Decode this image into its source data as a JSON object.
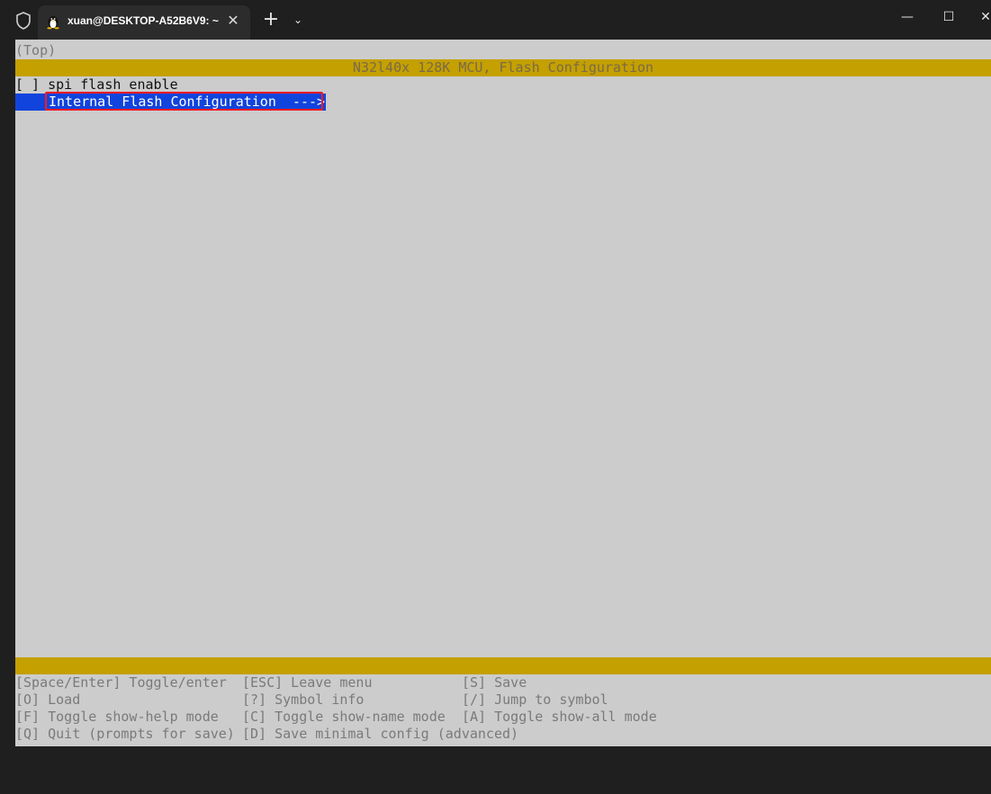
{
  "window": {
    "tab_title": "xuan@DESKTOP-A52B6V9: ~/",
    "tab_close": "✕",
    "new_tab": "+",
    "tab_dropdown": "⌄",
    "minimize": "—",
    "maximize": "☐",
    "close": "✕",
    "icons": [
      "shield-icon",
      "linux-penguin-icon"
    ]
  },
  "terminal": {
    "breadcrumb": "(Top)",
    "menu_title": "N32l40x 128K MCU, Flash Configuration",
    "items": [
      {
        "checkbox": "[ ]",
        "label": "spi flash enable"
      },
      {
        "label": "Internal Flash Configuration  --->"
      }
    ],
    "help": [
      [
        "[Space/Enter] Toggle/enter",
        "[ESC] Leave menu",
        "[S] Save"
      ],
      [
        "[O] Load",
        "[?] Symbol info",
        "[/] Jump to symbol"
      ],
      [
        "[F] Toggle show-help mode",
        "[C] Toggle show-name mode",
        "[A] Toggle show-all mode"
      ],
      [
        "[Q] Quit (prompts for save)",
        "[D] Save minimal config (advanced)",
        ""
      ]
    ]
  },
  "colors": {
    "terminal_bg": "#cccccc",
    "title_strip": "#c4a000",
    "selected_row": "#1144dd",
    "annotation_box": "#ff1a1a"
  }
}
